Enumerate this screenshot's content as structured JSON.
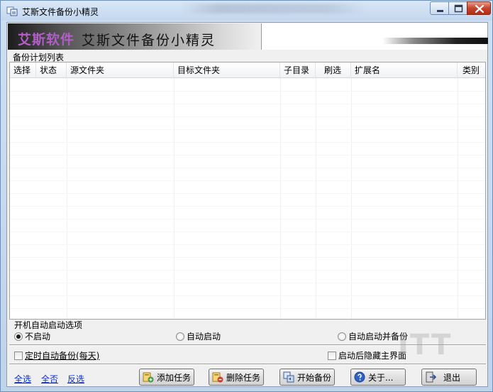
{
  "window": {
    "title": "艾斯文件备份小精灵"
  },
  "banner": {
    "logo_text": "艾斯软件",
    "title": "艾斯文件备份小精灵"
  },
  "list": {
    "caption": "备份计划列表",
    "columns": [
      "选择",
      "状态",
      "源文件夹",
      "目标文件夹",
      "子目录",
      "刷选",
      "扩展名",
      "类别"
    ],
    "rows": []
  },
  "startup": {
    "caption": "开机自动启动选项",
    "options": [
      "不启动",
      "自动启动",
      "自动启动并备份"
    ],
    "selected": "不启动"
  },
  "checks": {
    "timed_backup": "定时自动备份(每天)",
    "hide_after_start": "启动后隐藏主界面"
  },
  "links": {
    "select_all": "全选",
    "select_none": "全否",
    "invert": "反选"
  },
  "buttons": {
    "add_task": "添加任务",
    "delete_task": "删除任务",
    "start_backup": "开始备份",
    "about": "关于...",
    "exit": "退出"
  },
  "colors": {
    "logo": "#b15ec8",
    "link": "#0a2fd6",
    "close_button": "#c7432a"
  }
}
